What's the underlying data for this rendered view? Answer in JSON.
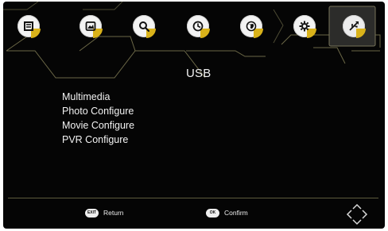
{
  "menu_icons": [
    {
      "name": "channel-list-icon",
      "active": false
    },
    {
      "name": "picture-icon",
      "active": false
    },
    {
      "name": "search-icon",
      "active": false
    },
    {
      "name": "clock-icon",
      "active": false
    },
    {
      "name": "globe-icon",
      "active": false
    },
    {
      "name": "gear-icon",
      "active": false
    },
    {
      "name": "usb-icon",
      "active": true
    }
  ],
  "page": {
    "title": "USB"
  },
  "menu": {
    "items": [
      "Multimedia",
      "Photo Configure",
      "Movie Configure",
      "PVR Configure"
    ]
  },
  "footer": {
    "return_key": "EXIT",
    "return_label": "Return",
    "confirm_key": "OK",
    "confirm_label": "Confirm"
  },
  "colors": {
    "background": "#050505",
    "accent": "#d9b21a",
    "line": "#5d5a3d",
    "text": "#f2f2f2"
  }
}
